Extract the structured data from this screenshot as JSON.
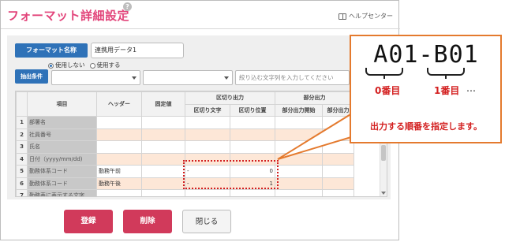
{
  "window": {
    "title": "フォーマット詳細設定",
    "help_icon": "?",
    "help_center": "ヘルプセンター"
  },
  "form": {
    "name_label": "フォーマット名称",
    "name_value": "連携用データ1",
    "condition_label": "抽出条件",
    "radio_off": "使用しない",
    "radio_on": "使用する",
    "radio_selected": "使用しない",
    "search_placeholder": "絞り込む文字列を入力してください"
  },
  "table": {
    "headers": {
      "item": "項目",
      "header": "ヘッダー",
      "fixed": "固定値",
      "delim_group": "区切り出力",
      "delim_char": "区切り文字",
      "delim_pos": "区切り位置",
      "partial_group": "部分出力",
      "partial_start": "部分出力開始",
      "partial_rest": "部分出力"
    },
    "rows": [
      {
        "no": "1",
        "item": "部署名",
        "header": "",
        "fixed": "",
        "delim_char": "",
        "delim_pos": "",
        "start": "",
        "rest": ""
      },
      {
        "no": "2",
        "item": "社員番号",
        "header": "",
        "fixed": "",
        "delim_char": "",
        "delim_pos": "",
        "start": "",
        "rest": ""
      },
      {
        "no": "3",
        "item": "氏名",
        "header": "",
        "fixed": "",
        "delim_char": "",
        "delim_pos": "",
        "start": "",
        "rest": ""
      },
      {
        "no": "4",
        "item": "日付（yyyy/mm/dd)",
        "header": "",
        "fixed": "",
        "delim_char": "",
        "delim_pos": "",
        "start": "",
        "rest": ""
      },
      {
        "no": "5",
        "item": "勤務体系コード",
        "header": "勤務午前",
        "fixed": "",
        "delim_char": "-",
        "delim_pos": "0",
        "start": "",
        "rest": ""
      },
      {
        "no": "6",
        "item": "勤務体系コード",
        "header": "勤務午後",
        "fixed": "",
        "delim_char": "-",
        "delim_pos": "1",
        "start": "",
        "rest": ""
      },
      {
        "no": "7",
        "item": "勤務表に表示する文字…",
        "header": "",
        "fixed": "",
        "delim_char": "",
        "delim_pos": "",
        "start": "",
        "rest": ""
      }
    ]
  },
  "buttons": {
    "register": "登録",
    "delete": "削除",
    "close": "閉じる"
  },
  "callout": {
    "code": "A01-B01",
    "first_label": "0番目",
    "second_label": "1番目",
    "dots": "…",
    "message": "出力する順番を指定します。"
  }
}
